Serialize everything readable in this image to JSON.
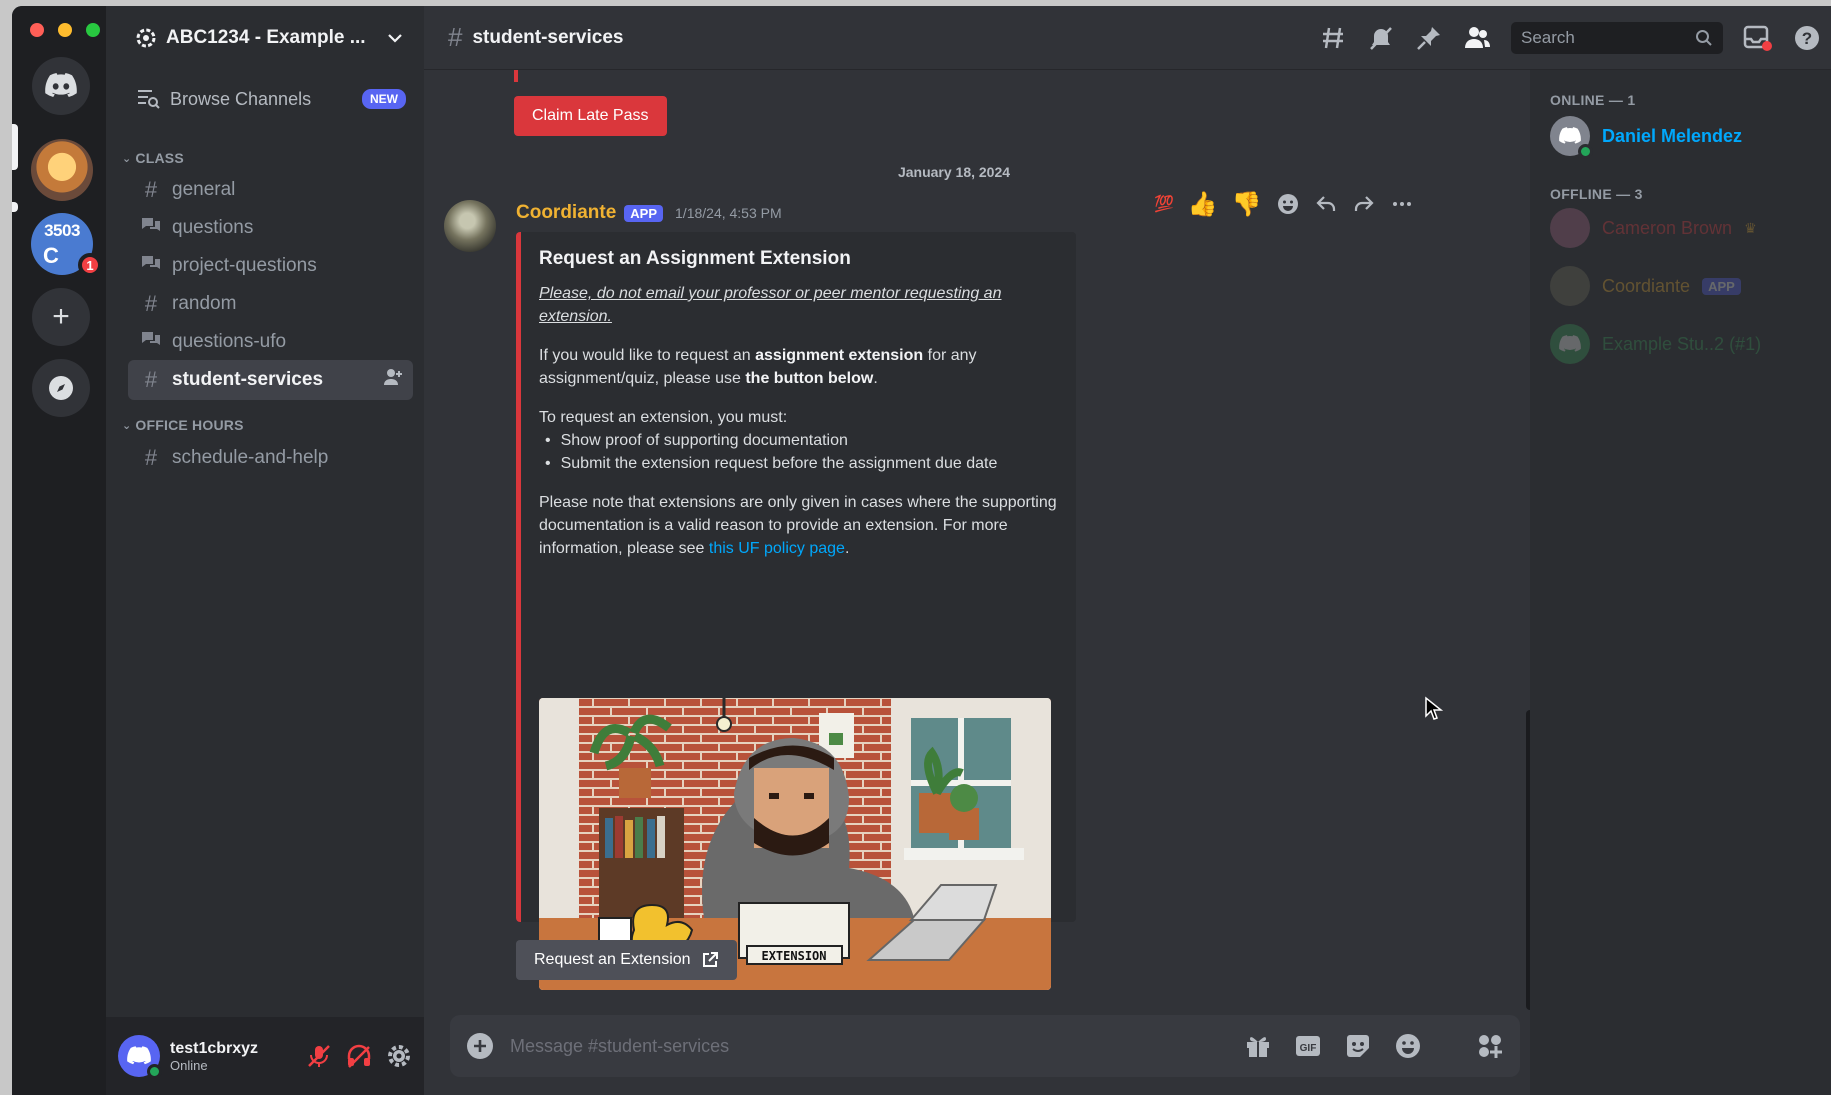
{
  "server": {
    "name": "ABC1234 - Example ...",
    "server_badge": "1",
    "server_number": "3503"
  },
  "sidebar": {
    "browse_label": "Browse Channels",
    "new_badge": "NEW",
    "categories": [
      {
        "label": "CLASS"
      },
      {
        "label": "OFFICE HOURS"
      }
    ],
    "channels": [
      {
        "name": "general"
      },
      {
        "name": "questions"
      },
      {
        "name": "project-questions"
      },
      {
        "name": "random"
      },
      {
        "name": "questions-ufo"
      },
      {
        "name": "student-services"
      },
      {
        "name": "schedule-and-help"
      }
    ]
  },
  "user": {
    "username": "test1cbrxyz",
    "status": "Online"
  },
  "header": {
    "channel": "student-services",
    "search_placeholder": "Search"
  },
  "messages": {
    "claim_button": "Claim Late Pass",
    "date_divider": "January 18, 2024",
    "author": "Coordiante",
    "app_badge": "APP",
    "timestamp": "1/18/24, 4:53 PM",
    "embed": {
      "title": "Request an Assignment Extension",
      "notice": "Please, do not email your professor or peer mentor requesting an extension.",
      "p1_a": "If you would like to request an ",
      "p1_b": "assignment extension",
      "p1_c": " for any assignment/quiz, please use ",
      "p1_d": "the button below",
      "p1_e": ".",
      "p2": "To request an extension, you must:",
      "bullets": [
        "Show proof of supporting documentation",
        "Submit the extension request before the assignment due date"
      ],
      "p3": "Please note that extensions are only given in cases where the supporting documentation is a valid reason to provide an extension. For more information, please see ",
      "p3_link": "this UF policy page",
      "p3_end": ".",
      "image_label": "EXTENSION"
    },
    "extension_button": "Request an Extension"
  },
  "composer": {
    "placeholder": "Message #student-services"
  },
  "members": {
    "online_label": "ONLINE — 1",
    "offline_label": "OFFLINE — 3",
    "online": [
      {
        "name": "Daniel Melendez"
      }
    ],
    "offline": [
      {
        "name": "Cameron Brown"
      },
      {
        "name": "Coordiante",
        "badge": "APP"
      },
      {
        "name": "Example Stu..2 (#1)"
      }
    ]
  },
  "colors": {
    "accent": "#5865f2",
    "danger": "#da373c",
    "author": "#f0b232",
    "link": "#00a8fc",
    "online": "#23a559"
  }
}
